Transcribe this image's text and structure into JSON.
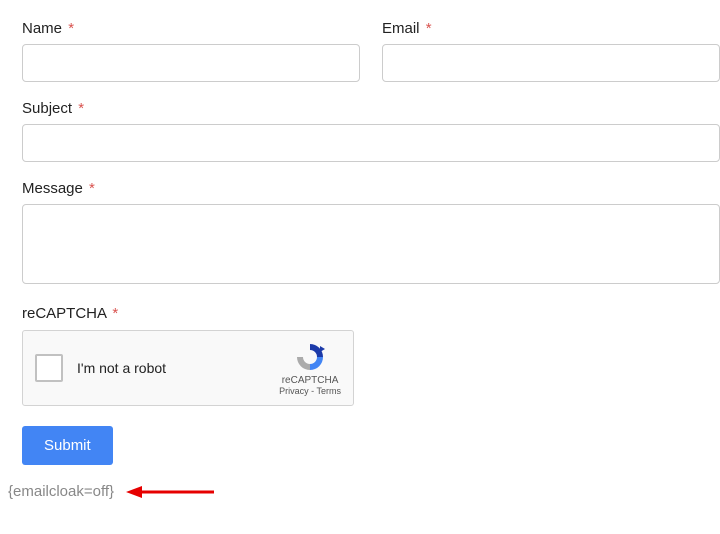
{
  "form": {
    "name": {
      "label": "Name",
      "value": ""
    },
    "email": {
      "label": "Email",
      "value": ""
    },
    "subject": {
      "label": "Subject",
      "value": ""
    },
    "message": {
      "label": "Message",
      "value": ""
    },
    "recaptcha": {
      "label": "reCAPTCHA",
      "checkbox_label": "I'm not a robot",
      "brand": "reCAPTCHA",
      "privacy": "Privacy",
      "terms": "Terms",
      "separator": " - "
    },
    "submit": "Submit",
    "required_mark": "*"
  },
  "footer": {
    "emailcloak": "{emailcloak=off}"
  }
}
